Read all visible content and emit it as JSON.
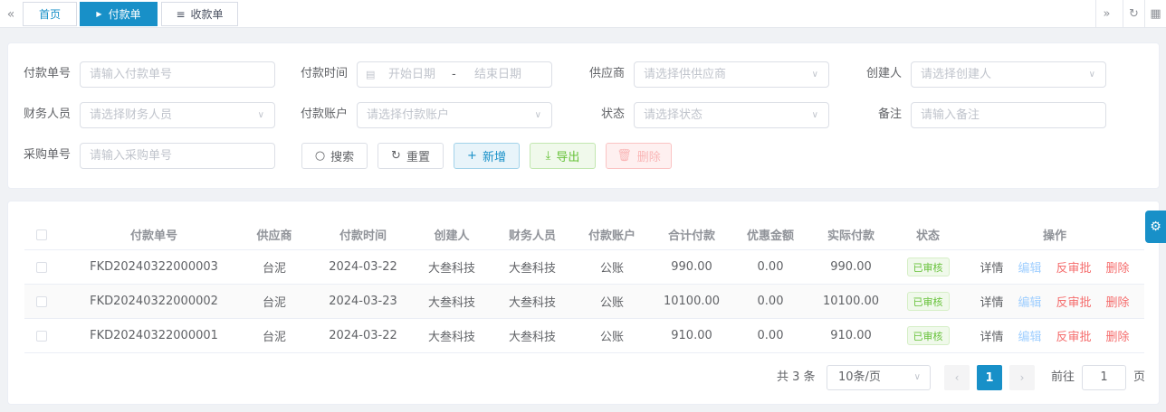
{
  "tabbar": {
    "tabs": [
      {
        "label": "首页"
      },
      {
        "label": "付款单"
      },
      {
        "label": "收款单"
      }
    ]
  },
  "search": {
    "payment_no": {
      "label": "付款单号",
      "placeholder": "请输入付款单号"
    },
    "payment_time": {
      "label": "付款时间",
      "start": "开始日期",
      "sep": "-",
      "end": "结束日期"
    },
    "supplier": {
      "label": "供应商",
      "placeholder": "请选择供供应商"
    },
    "creator": {
      "label": "创建人",
      "placeholder": "请选择创建人"
    },
    "finance": {
      "label": "财务人员",
      "placeholder": "请选择财务人员"
    },
    "account": {
      "label": "付款账户",
      "placeholder": "请选择付款账户"
    },
    "status": {
      "label": "状态",
      "placeholder": "请选择状态"
    },
    "remark": {
      "label": "备注",
      "placeholder": "请输入备注"
    },
    "purchase_no": {
      "label": "采购单号",
      "placeholder": "请输入采购单号"
    }
  },
  "buttons": {
    "search": "搜索",
    "reset": "重置",
    "add": "新增",
    "export": "导出",
    "delete": "删除"
  },
  "table": {
    "headers": [
      "付款单号",
      "供应商",
      "付款时间",
      "创建人",
      "财务人员",
      "付款账户",
      "合计付款",
      "优惠金额",
      "实际付款",
      "状态",
      "操作"
    ],
    "rows": [
      {
        "no": "FKD20240322000003",
        "supplier": "台泥",
        "time": "2024-03-22",
        "creator": "大叁科技",
        "finance": "大叁科技",
        "account": "公账",
        "total": "990.00",
        "discount": "0.00",
        "actual": "990.00",
        "status": "已审核"
      },
      {
        "no": "FKD20240322000002",
        "supplier": "台泥",
        "time": "2024-03-23",
        "creator": "大叁科技",
        "finance": "大叁科技",
        "account": "公账",
        "total": "10100.00",
        "discount": "0.00",
        "actual": "10100.00",
        "status": "已审核"
      },
      {
        "no": "FKD20240322000001",
        "supplier": "台泥",
        "time": "2024-03-22",
        "creator": "大叁科技",
        "finance": "大叁科技",
        "account": "公账",
        "total": "910.00",
        "discount": "0.00",
        "actual": "910.00",
        "status": "已审核"
      }
    ],
    "actions": {
      "detail": "详情",
      "edit": "编辑",
      "revert": "反审批",
      "delete": "删除"
    }
  },
  "pagination": {
    "total": "共 3 条",
    "page_size": "10条/页",
    "current": "1",
    "goto_label": "前往",
    "goto_value": "1",
    "goto_suffix": "页"
  },
  "colors": {
    "primary": "#1890c8",
    "success": "#67c23a",
    "danger": "#f56c6c"
  }
}
